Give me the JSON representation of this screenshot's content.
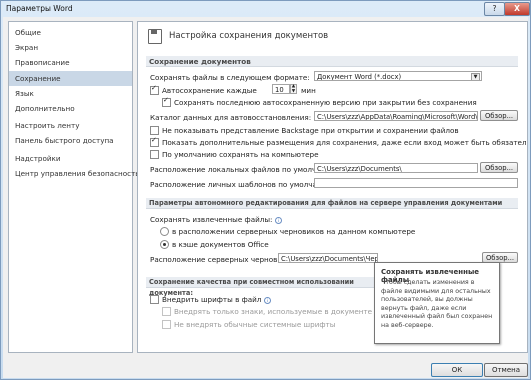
{
  "window": {
    "title": "Параметры Word",
    "help": "?",
    "close": "X"
  },
  "sidebar": {
    "items": [
      {
        "label": "Общие"
      },
      {
        "label": "Экран"
      },
      {
        "label": "Правописание"
      },
      {
        "label": "Сохранение"
      },
      {
        "label": "Язык"
      },
      {
        "label": "Дополнительно"
      },
      {
        "label": "Настроить ленту"
      },
      {
        "label": "Панель быстрого доступа"
      },
      {
        "label": "Надстройки"
      },
      {
        "label": "Центр управления безопасностью"
      }
    ],
    "active": "Сохранение"
  },
  "main": {
    "header": "Настройка сохранения документов",
    "sections": {
      "save_docs": "Сохранение документов",
      "offline": "Параметры автономного редактирования для файлов на сервере управления документами",
      "quality": "Сохранение качества при совместном использовании документа:"
    },
    "save_format_label": "Сохранять файлы в следующем формате:",
    "save_format_value": "Документ Word (*.docx)",
    "autosave_label": "Автосохранение каждые",
    "autosave_value": "10",
    "autosave_unit": "мин",
    "keep_last_label": "Сохранять последнюю автосохраненную версию при закрытии без сохранения",
    "autorecover_label": "Каталог данных для автовосстановления:",
    "autorecover_path": "C:\\Users\\zzz\\AppData\\Roaming\\Microsoft\\Word\\",
    "browse": "Обзор...",
    "no_backstage_label": "Не показывать представление Backstage при открытии и сохранении файлов",
    "show_extra_label": "Показать дополнительные размещения для сохранения, даже если вход может быть обязательным",
    "default_local_label": "По умолчанию сохранять на компьютере",
    "local_default_label": "Расположение локальных файлов по умолчанию:",
    "local_default_path": "C:\\Users\\zzz\\Documents\\",
    "personal_templates_label": "Расположение личных шаблонов по умолчанию:",
    "personal_templates_path": "",
    "save_checked_out_label": "Сохранять извлеченные файлы:",
    "radio_server": "в расположении серверных черновиков на данном компьютере",
    "radio_office": "в кэше документов Office",
    "server_drafts_label": "Расположение серверных черновиков:",
    "server_drafts_path": "C:\\Users\\zzz\\Documents\\Черно",
    "quality_doc": "",
    "embed_fonts_label": "Внедрить шрифты в файл",
    "embed_used_label": "Внедрять только знаки, используемые в документе (уменьшение",
    "no_common_label": "Не внедрять обычные системные шрифты"
  },
  "tooltip": {
    "title": "Сохранять извлеченные файлы",
    "body": "Чтобы сделать изменения в файле видимыми для остальных пользователей, вы должны вернуть файл, даже если извлеченный файл был сохранен на веб-сервере."
  },
  "footer": {
    "ok": "ОК",
    "cancel": "Отмена"
  }
}
